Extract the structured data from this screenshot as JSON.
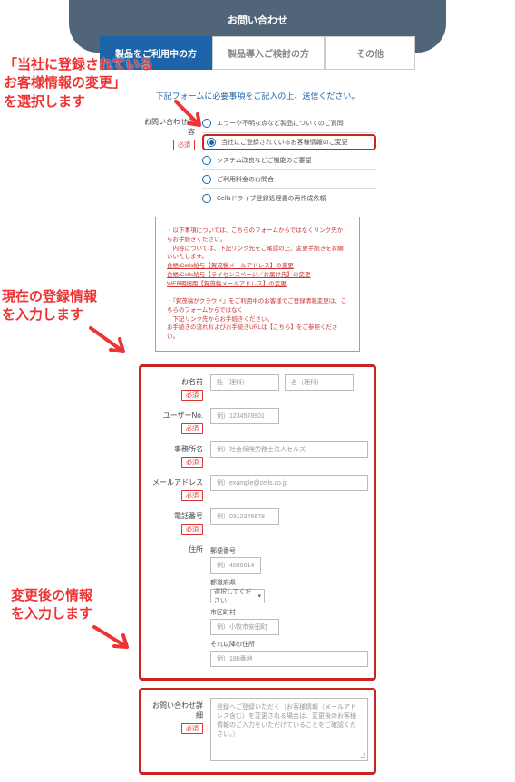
{
  "header": {
    "title": "お問い合わせ"
  },
  "tabs": {
    "t1": "製品をご利用中の方",
    "t2": "製品導入ご検討の方",
    "t3": "その他"
  },
  "intro": "下記フォームに必要事項をご記入の上、送信ください。",
  "inquiry_type": {
    "label": "お問い合わせ内容",
    "required": "必須",
    "options": {
      "o1": "エラーや不明な点など製品についてのご質問",
      "o2": "当社にご登録されているお客様情報のご変更",
      "o3": "システム改良などご機能のご要望",
      "o4": "ご利用料金のお問合",
      "o5": "Cellsドライブ登録処理書の再作成依頼"
    }
  },
  "notice": {
    "l1": "・以下事項については、こちらのフォームからではなくリンク先からお手続きください。",
    "l2": "　内容については、下記リンク先をご確認の上、変更手続きをお願いいたします。",
    "l3": "台帳/Cells給与【賀茂稿メールアドレス】の変更",
    "l4": "台帳/Cells給与【ライセンスページ／お届け先】の変更",
    "l5": "WEB明細用【賀茂稿メールアドレス】の変更",
    "l6": "・『賀茂稿がクラウド』をご利用中のお客様でご登録情報変更は、こちらのフォームからではなく",
    "l7": "　下記リンク先からお手続きください。",
    "l8": "お手続きの流れおよびお手続きURLは【こちら】をご参照ください。"
  },
  "fields": {
    "name": {
      "label": "お名前",
      "ph1": "姓（理科）",
      "ph2": "名（理科）"
    },
    "userno": {
      "label": "ユーザーNo.",
      "ph": "例）1234578901"
    },
    "office": {
      "label": "事務所名",
      "ph": "例）社会保険労務士法人セルズ"
    },
    "email": {
      "label": "メールアドレス",
      "ph": "例）example@cells.co.jp"
    },
    "tel": {
      "label": "電話番号",
      "ph": "例）0312345678"
    },
    "address": {
      "label": "住所",
      "zip_lbl": "郵便番号",
      "zip_ph": "例）4800014",
      "pref_lbl": "都道府県",
      "pref_ph": "選択してください",
      "city_lbl": "市区町村",
      "city_ph": "例）小牧市安田町",
      "rest_lbl": "それ以降の住所",
      "rest_ph": "例）180番地"
    },
    "detail": {
      "label": "お問い合わせ詳細",
      "ph": "登録へご登録いただく（お客様情報（メールアドレス含む）を変更される場合は、変更後のお客様情報のご入力をいただけていることをご確認ください。）"
    },
    "required": "必須"
  },
  "annotations": {
    "a1": "「当社に登録されている\nお客様情報の変更」\nを選択します",
    "a2": "現在の登録情報\nを入力します",
    "a3": "変更後の情報\nを入力します"
  }
}
